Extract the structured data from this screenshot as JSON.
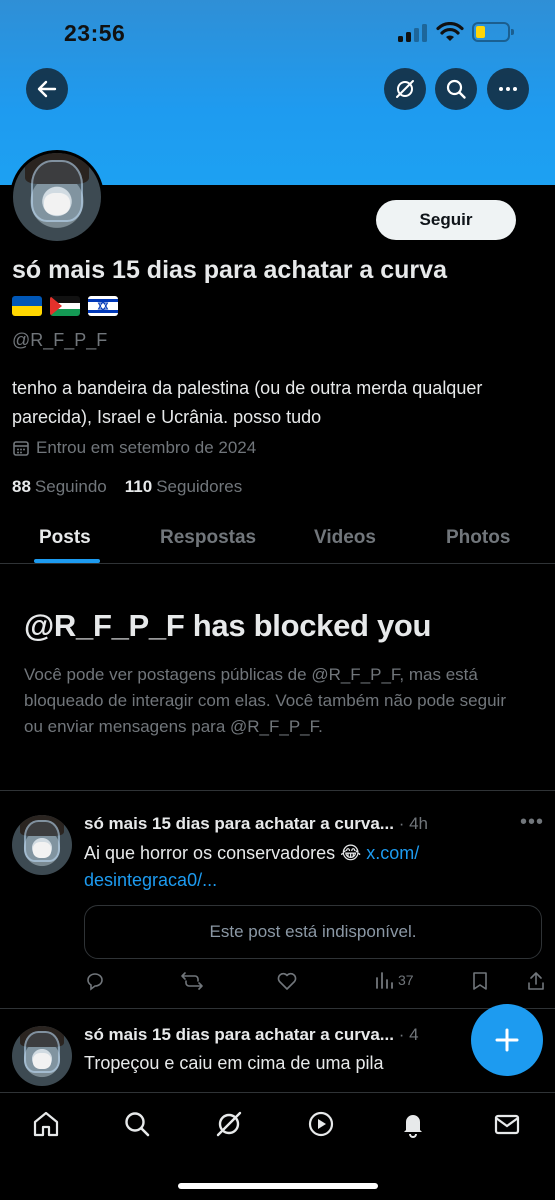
{
  "status_bar": {
    "time": "23:56"
  },
  "profile": {
    "display_name": "só mais 15 dias para achatar a curva",
    "flags": [
      "ukraine-flag",
      "palestine-flag",
      "israel-flag"
    ],
    "handle": "@R_F_P_F",
    "bio": "tenho a bandeira da palestina (ou de outra merda qualquer parecida), Israel e Ucrânia. posso tudo",
    "joined": "Entrou em setembro de 2024",
    "following_count": "88",
    "following_label": "Seguindo",
    "followers_count": "110",
    "followers_label": "Seguidores",
    "follow_button": "Seguir"
  },
  "tabs": [
    {
      "label": "Posts",
      "active": true
    },
    {
      "label": "Respostas",
      "active": false
    },
    {
      "label": "Videos",
      "active": false
    },
    {
      "label": "Photos",
      "active": false
    }
  ],
  "blocked": {
    "title": "@R_F_P_F has blocked you",
    "message": "Você pode ver postagens públicas de @R_F_P_F, mas está bloqueado de interagir com elas. Você também não pode seguir ou enviar mensagens para @R_F_P_F."
  },
  "posts": [
    {
      "author": "só mais 15 dias para achatar a curva...",
      "time": "· 4h",
      "text": "Ai que horror os conservadores 😂",
      "link": "x.com/ desintegraca0/...",
      "quoted": "Este post está indisponível.",
      "views": "37"
    },
    {
      "author": "só mais 15 dias para achatar a curva...",
      "time": "· 4",
      "text": "Tropeçou e caiu em cima de uma pila"
    }
  ],
  "colors": {
    "accent": "#1d9bf0",
    "banner": "#1e9bf0",
    "background": "#000000",
    "muted": "#71767b"
  }
}
